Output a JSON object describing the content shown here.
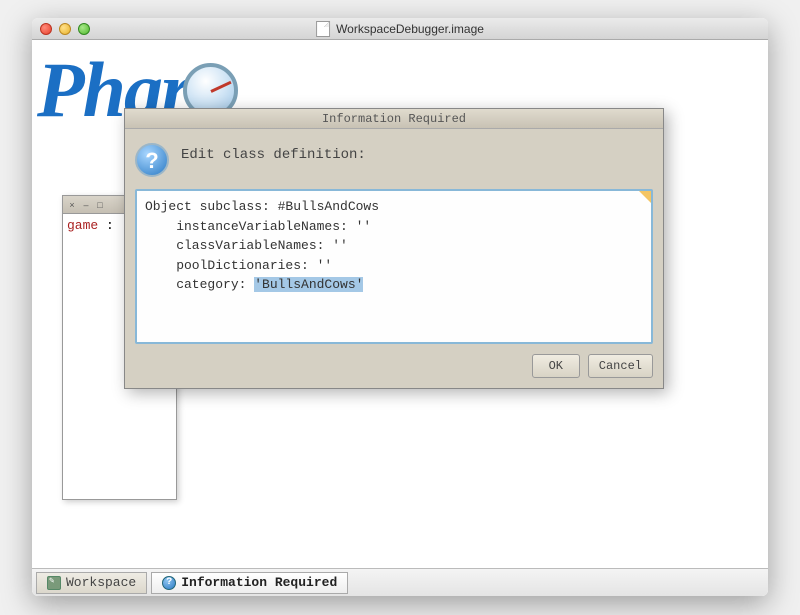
{
  "window": {
    "title": "WorkspaceDebugger.image"
  },
  "logo": {
    "text": "Phar"
  },
  "workspace": {
    "text_red": "game",
    "text_rest": " :"
  },
  "dialog": {
    "title": "Information Required",
    "prompt": "Edit class definition:",
    "code": {
      "line1": "Object subclass: #BullsAndCows",
      "line2": "    instanceVariableNames: ''",
      "line3": "    classVariableNames: ''",
      "line4": "    poolDictionaries: ''",
      "line5_a": "    category: ",
      "line5_b": "'BullsAndCows'"
    },
    "ok": "OK",
    "cancel": "Cancel"
  },
  "taskbar": {
    "workspace": "Workspace",
    "info": "Information Required"
  }
}
